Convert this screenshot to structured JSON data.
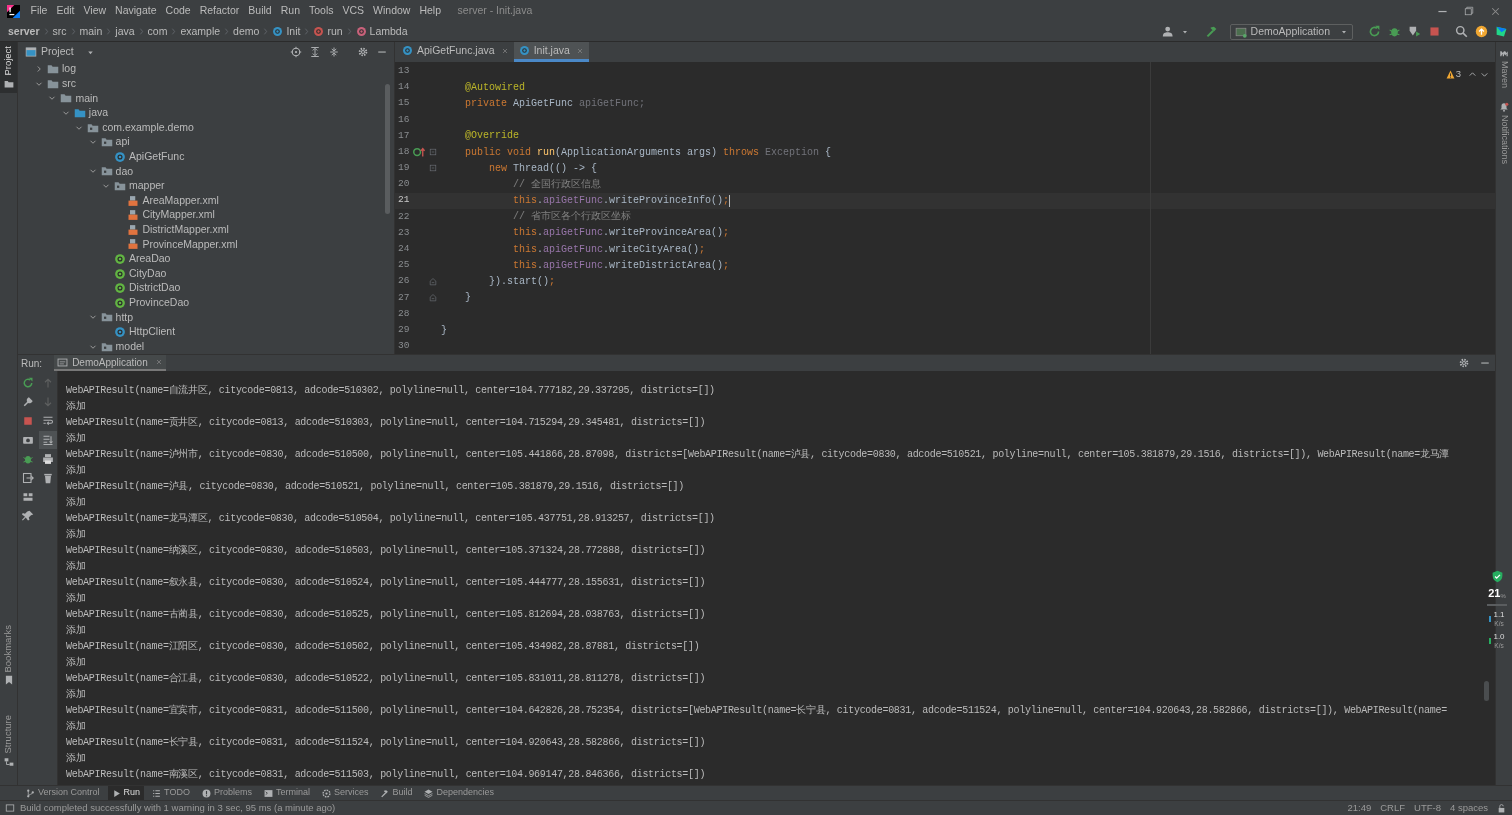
{
  "menu_bar": {
    "items": [
      "File",
      "Edit",
      "View",
      "Navigate",
      "Code",
      "Refactor",
      "Build",
      "Run",
      "Tools",
      "VCS",
      "Window",
      "Help"
    ],
    "title": "server - Init.java"
  },
  "breadcrumbs": [
    {
      "label": "server",
      "kind": "project"
    },
    {
      "label": "src",
      "kind": "folder"
    },
    {
      "label": "main",
      "kind": "folder"
    },
    {
      "label": "java",
      "kind": "folder"
    },
    {
      "label": "com",
      "kind": "folder"
    },
    {
      "label": "example",
      "kind": "folder"
    },
    {
      "label": "demo",
      "kind": "folder"
    },
    {
      "label": "Init",
      "kind": "class"
    },
    {
      "label": "run",
      "kind": "method"
    },
    {
      "label": "Lambda",
      "kind": "lambda"
    }
  ],
  "run_config": {
    "label": "DemoApplication"
  },
  "left_strip": [
    {
      "label": "Project",
      "selected": true
    },
    {
      "label": "Bookmarks",
      "selected": false
    },
    {
      "label": "Structure",
      "selected": false
    }
  ],
  "right_strip": [
    {
      "label": "Maven",
      "selected": false
    },
    {
      "label": "Notifications",
      "selected": false
    }
  ],
  "project_panel": {
    "title": "Project",
    "tree": [
      {
        "label": "log",
        "kind": "folder",
        "expanded": false
      },
      {
        "label": "src",
        "kind": "folder",
        "expanded": true,
        "children": [
          {
            "label": "main",
            "kind": "folder",
            "expanded": true,
            "children": [
              {
                "label": "java",
                "kind": "source_folder",
                "expanded": true,
                "children": [
                  {
                    "label": "com.example.demo",
                    "kind": "package",
                    "expanded": true,
                    "children": [
                      {
                        "label": "api",
                        "kind": "package",
                        "expanded": true,
                        "children": [
                          {
                            "label": "ApiGetFunc",
                            "kind": "class"
                          }
                        ]
                      },
                      {
                        "label": "dao",
                        "kind": "package",
                        "expanded": true,
                        "children": [
                          {
                            "label": "mapper",
                            "kind": "package",
                            "expanded": true,
                            "children": [
                              {
                                "label": "AreaMapper.xml",
                                "kind": "xml"
                              },
                              {
                                "label": "CityMapper.xml",
                                "kind": "xml"
                              },
                              {
                                "label": "DistrictMapper.xml",
                                "kind": "xml"
                              },
                              {
                                "label": "ProvinceMapper.xml",
                                "kind": "xml"
                              }
                            ]
                          },
                          {
                            "label": "AreaDao",
                            "kind": "interface"
                          },
                          {
                            "label": "CityDao",
                            "kind": "interface"
                          },
                          {
                            "label": "DistrictDao",
                            "kind": "interface"
                          },
                          {
                            "label": "ProvinceDao",
                            "kind": "interface"
                          }
                        ]
                      },
                      {
                        "label": "http",
                        "kind": "package",
                        "expanded": true,
                        "children": [
                          {
                            "label": "HttpClient",
                            "kind": "class"
                          }
                        ]
                      },
                      {
                        "label": "model",
                        "kind": "package",
                        "expanded": true
                      }
                    ]
                  }
                ]
              }
            ]
          }
        ]
      }
    ]
  },
  "editor": {
    "tabs": [
      {
        "label": "ApiGetFunc.java",
        "selected": false
      },
      {
        "label": "Init.java",
        "selected": true
      }
    ],
    "warnings": "3",
    "lines": [
      {
        "number": "13",
        "current": false,
        "override": false,
        "fold_start": false,
        "fold_end": false
      },
      {
        "number": "14",
        "current": false,
        "override": false,
        "fold_start": false,
        "fold_end": false,
        "tokens": [
          {
            "text": "    @Autowired",
            "kind": "annotation"
          }
        ]
      },
      {
        "number": "15",
        "current": false,
        "override": false,
        "fold_start": false,
        "fold_end": false,
        "tokens": [
          {
            "text": "    private",
            "kind": "keyword"
          },
          {
            "text": " ApiGetFunc ",
            "kind": "plain"
          },
          {
            "text": "apiGetFunc;",
            "kind": "unused"
          }
        ]
      },
      {
        "number": "16",
        "current": false,
        "override": false,
        "fold_start": false,
        "fold_end": false
      },
      {
        "number": "17",
        "current": false,
        "override": false,
        "fold_start": false,
        "fold_end": false,
        "tokens": [
          {
            "text": "    @Override",
            "kind": "annotation"
          }
        ]
      },
      {
        "number": "18",
        "current": false,
        "override": true,
        "fold_start": true,
        "fold_end": false,
        "tokens": [
          {
            "text": "    public void ",
            "kind": "keyword"
          },
          {
            "text": "run",
            "kind": "method"
          },
          {
            "text": "(ApplicationArguments args) ",
            "kind": "plain"
          },
          {
            "text": "throws ",
            "kind": "keyword"
          },
          {
            "text": "Exception",
            "kind": "unused"
          },
          {
            "text": " {",
            "kind": "plain"
          }
        ]
      },
      {
        "number": "19",
        "current": false,
        "override": false,
        "fold_start": true,
        "fold_end": false,
        "tokens": [
          {
            "text": "        new ",
            "kind": "keyword"
          },
          {
            "text": "Thread(() -> {",
            "kind": "plain"
          }
        ]
      },
      {
        "number": "20",
        "current": false,
        "override": false,
        "fold_start": false,
        "fold_end": false,
        "tokens": [
          {
            "text": "            // 全国行政区信息",
            "kind": "comment"
          }
        ]
      },
      {
        "number": "21",
        "current": true,
        "override": false,
        "fold_start": false,
        "fold_end": false,
        "tokens": [
          {
            "text": "            this",
            "kind": "keyword"
          },
          {
            "text": ".",
            "kind": "plain"
          },
          {
            "text": "apiGetFunc",
            "kind": "field"
          },
          {
            "text": ".writeProvinceInfo()",
            "kind": "plain"
          },
          {
            "text": ";",
            "kind": "keyword"
          }
        ]
      },
      {
        "number": "22",
        "current": false,
        "override": false,
        "fold_start": false,
        "fold_end": false,
        "tokens": [
          {
            "text": "            // 省市区各个行政区坐标",
            "kind": "comment"
          }
        ]
      },
      {
        "number": "23",
        "current": false,
        "override": false,
        "fold_start": false,
        "fold_end": false,
        "tokens": [
          {
            "text": "            this",
            "kind": "keyword"
          },
          {
            "text": ".",
            "kind": "plain"
          },
          {
            "text": "apiGetFunc",
            "kind": "field"
          },
          {
            "text": ".writeProvinceArea()",
            "kind": "plain"
          },
          {
            "text": ";",
            "kind": "keyword"
          }
        ]
      },
      {
        "number": "24",
        "current": false,
        "override": false,
        "fold_start": false,
        "fold_end": false,
        "tokens": [
          {
            "text": "            this",
            "kind": "keyword"
          },
          {
            "text": ".",
            "kind": "plain"
          },
          {
            "text": "apiGetFunc",
            "kind": "field"
          },
          {
            "text": ".writeCityArea()",
            "kind": "plain"
          },
          {
            "text": ";",
            "kind": "keyword"
          }
        ]
      },
      {
        "number": "25",
        "current": false,
        "override": false,
        "fold_start": false,
        "fold_end": false,
        "tokens": [
          {
            "text": "            this",
            "kind": "keyword"
          },
          {
            "text": ".",
            "kind": "plain"
          },
          {
            "text": "apiGetFunc",
            "kind": "field"
          },
          {
            "text": ".writeDistrictArea()",
            "kind": "plain"
          },
          {
            "text": ";",
            "kind": "keyword"
          }
        ]
      },
      {
        "number": "26",
        "current": false,
        "override": false,
        "fold_start": false,
        "fold_end": true,
        "tokens": [
          {
            "text": "        }).start()",
            "kind": "plain"
          },
          {
            "text": ";",
            "kind": "keyword"
          }
        ]
      },
      {
        "number": "27",
        "current": false,
        "override": false,
        "fold_start": false,
        "fold_end": true,
        "tokens": [
          {
            "text": "    }",
            "kind": "plain"
          }
        ]
      },
      {
        "number": "28",
        "current": false,
        "override": false,
        "fold_start": false,
        "fold_end": false
      },
      {
        "number": "29",
        "current": false,
        "override": false,
        "fold_start": false,
        "fold_end": false,
        "tokens": [
          {
            "text": "}",
            "kind": "plain"
          }
        ]
      },
      {
        "number": "30",
        "current": false,
        "override": false,
        "fold_start": false,
        "fold_end": false
      }
    ]
  },
  "run_panel": {
    "label": "Run:",
    "tab": {
      "label": "DemoApplication"
    },
    "console": [
      "WebAPIResult(name=自流井区, citycode=0813, adcode=510302, polyline=null, center=104.777182,29.337295, districts=[])",
      "添加",
      "WebAPIResult(name=贡井区, citycode=0813, adcode=510303, polyline=null, center=104.715294,29.345481, districts=[])",
      "添加",
      "WebAPIResult(name=泸州市, citycode=0830, adcode=510500, polyline=null, center=105.441866,28.87098, districts=[WebAPIResult(name=泸县, citycode=0830, adcode=510521, polyline=null, center=105.381879,29.1516, districts=[]), WebAPIResult(name=龙马潭",
      "添加",
      "WebAPIResult(name=泸县, citycode=0830, adcode=510521, polyline=null, center=105.381879,29.1516, districts=[])",
      "添加",
      "WebAPIResult(name=龙马潭区, citycode=0830, adcode=510504, polyline=null, center=105.437751,28.913257, districts=[])",
      "添加",
      "WebAPIResult(name=纳溪区, citycode=0830, adcode=510503, polyline=null, center=105.371324,28.772888, districts=[])",
      "添加",
      "WebAPIResult(name=叙永县, citycode=0830, adcode=510524, polyline=null, center=105.444777,28.155631, districts=[])",
      "添加",
      "WebAPIResult(name=古蔺县, citycode=0830, adcode=510525, polyline=null, center=105.812694,28.038763, districts=[])",
      "添加",
      "WebAPIResult(name=江阳区, citycode=0830, adcode=510502, polyline=null, center=105.434982,28.87881, districts=[])",
      "添加",
      "WebAPIResult(name=合江县, citycode=0830, adcode=510522, polyline=null, center=105.831011,28.811278, districts=[])",
      "添加",
      "WebAPIResult(name=宜宾市, citycode=0831, adcode=511500, polyline=null, center=104.642826,28.752354, districts=[WebAPIResult(name=长宁县, citycode=0831, adcode=511524, polyline=null, center=104.920643,28.582866, districts=[]), WebAPIResult(name=",
      "添加",
      "WebAPIResult(name=长宁县, citycode=0831, adcode=511524, polyline=null, center=104.920643,28.582866, districts=[])",
      "添加",
      "WebAPIResult(name=南溪区, citycode=0831, adcode=511503, polyline=null, center=104.969147,28.846366, districts=[])"
    ]
  },
  "monitor": {
    "cpu": "21",
    "cpu_unit": "%",
    "upload": "1.1",
    "upload_unit": "K/s",
    "download": "1.0",
    "download_unit": "K/s"
  },
  "tool_tabs": [
    {
      "label": "Version Control",
      "selected": false
    },
    {
      "label": "Run",
      "selected": true
    },
    {
      "label": "TODO",
      "selected": false
    },
    {
      "label": "Problems",
      "selected": false
    },
    {
      "label": "Terminal",
      "selected": false
    },
    {
      "label": "Services",
      "selected": false
    },
    {
      "label": "Build",
      "selected": false
    },
    {
      "label": "Dependencies",
      "selected": false
    }
  ],
  "status_bar": {
    "message": "Build completed successfully with 1 warning in 3 sec, 95 ms (a minute ago)",
    "items": [
      "21:49",
      "CRLF",
      "UTF-8",
      "4 spaces"
    ]
  }
}
